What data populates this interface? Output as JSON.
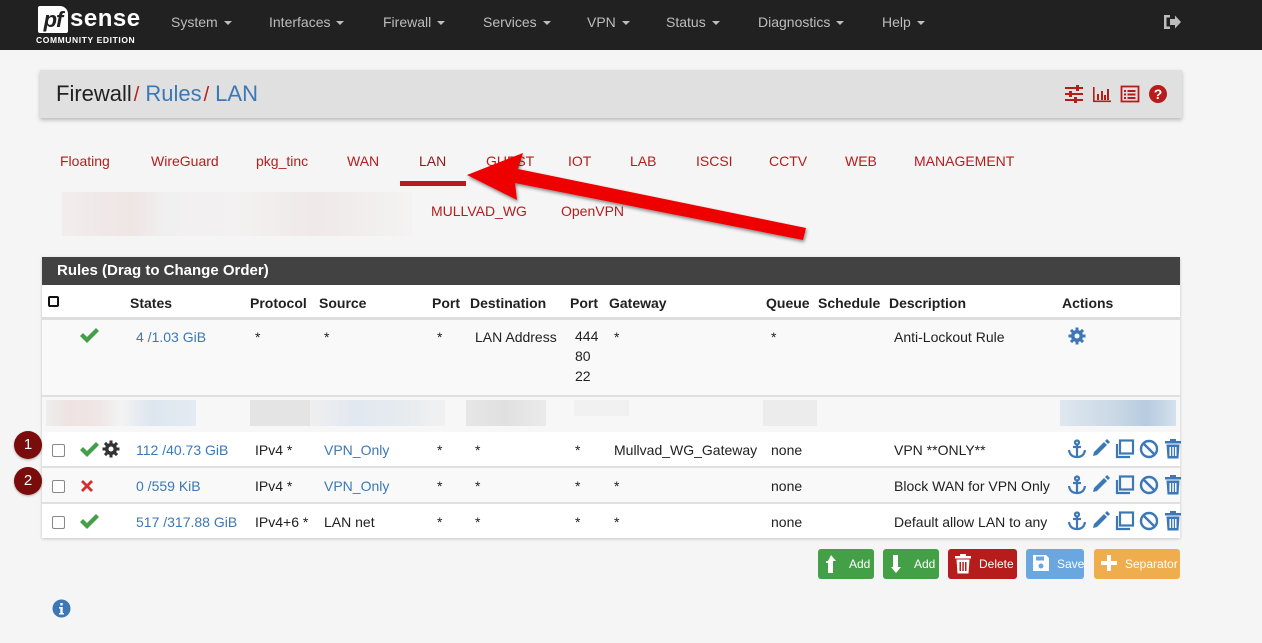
{
  "navbar": {
    "brand": {
      "logo_mark": "pf",
      "logo_text": "sense",
      "edition": "COMMUNITY EDITION"
    },
    "items": [
      {
        "label": "System"
      },
      {
        "label": "Interfaces"
      },
      {
        "label": "Firewall"
      },
      {
        "label": "Services"
      },
      {
        "label": "VPN"
      },
      {
        "label": "Status"
      },
      {
        "label": "Diagnostics"
      },
      {
        "label": "Help"
      }
    ],
    "logout_icon": "sign-out-icon"
  },
  "breadcrumb": {
    "items": [
      "Firewall",
      "Rules",
      "LAN"
    ],
    "separator": "/",
    "icons": [
      "sliders-icon",
      "bar-chart-icon",
      "list-icon",
      "help-icon"
    ]
  },
  "tabs": {
    "row1": [
      "Floating",
      "WireGuard",
      "pkg_tinc",
      "WAN",
      "LAN",
      "GUEST",
      "IOT",
      "LAB",
      "ISCSI",
      "CCTV",
      "WEB",
      "MANAGEMENT"
    ],
    "row2": [
      "MULLVAD_WG",
      "OpenVPN"
    ],
    "active": "LAN"
  },
  "rules": {
    "heading": "Rules (Drag to Change Order)",
    "columns": [
      "",
      "",
      "States",
      "Protocol",
      "Source",
      "Port",
      "Destination",
      "Port",
      "Gateway",
      "Queue",
      "Schedule",
      "Description",
      "Actions"
    ],
    "anti_lockout": {
      "status": "pass",
      "states": "4 /1.03 GiB",
      "protocol": "*",
      "source": "*",
      "source_port": "*",
      "destination": "LAN Address",
      "dest_ports": [
        "444",
        "80",
        "22"
      ],
      "gateway": "*",
      "queue": "*",
      "schedule": "",
      "description": "Anti-Lockout Rule"
    },
    "rows": [
      {
        "badge": "1",
        "status": "pass",
        "advanced": true,
        "states": "112 /40.73 GiB",
        "protocol": "IPv4 *",
        "source": "VPN_Only",
        "source_port": "*",
        "destination": "*",
        "dest_port": "*",
        "gateway": "Mullvad_WG_Gateway",
        "queue": "none",
        "schedule": "",
        "description": "VPN **ONLY**"
      },
      {
        "badge": "2",
        "status": "block",
        "advanced": false,
        "states": "0 /559 KiB",
        "protocol": "IPv4 *",
        "source": "VPN_Only",
        "source_port": "*",
        "destination": "*",
        "dest_port": "*",
        "gateway": "*",
        "queue": "none",
        "schedule": "",
        "description": "Block WAN for VPN Only"
      },
      {
        "badge": "",
        "status": "pass",
        "advanced": false,
        "states": "517 /317.88 GiB",
        "protocol": "IPv4+6 *",
        "source": "LAN net",
        "source_port": "*",
        "destination": "*",
        "dest_port": "*",
        "gateway": "*",
        "queue": "none",
        "schedule": "",
        "description": "Default allow LAN to any"
      }
    ],
    "row_actions": [
      "anchor-icon",
      "pencil-icon",
      "copy-icon",
      "disable-icon",
      "trash-icon"
    ]
  },
  "buttons": {
    "add_top": "Add",
    "add_bottom": "Add",
    "delete": "Delete",
    "save": "Save",
    "separator": "Separator"
  },
  "colors": {
    "navbar_bg": "#212121",
    "accent_red": "#b71c1c",
    "link_blue": "#3c78b5",
    "pass_green": "#43a047",
    "block_red": "#d32f2f",
    "panel_heading": "#424242",
    "btn_green": "#43a047",
    "btn_red": "#b71c1c",
    "btn_blue": "#6aa6e0",
    "btn_orange": "#f0ad4e"
  }
}
